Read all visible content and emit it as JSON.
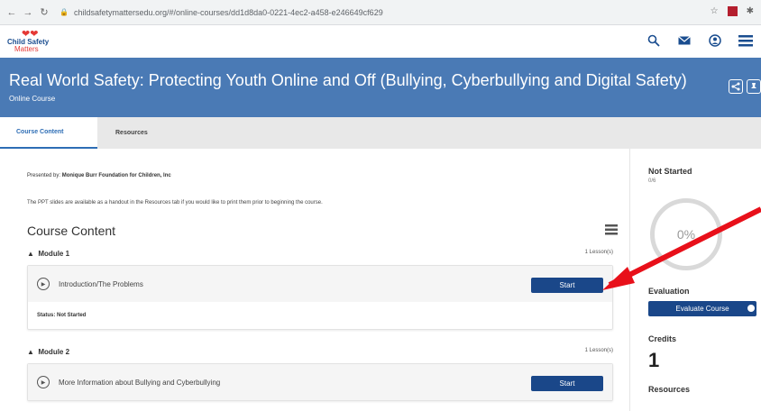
{
  "browser": {
    "url": "childsafetymattersedu.org/#/online-courses/dd1d8da0-0221-4ec2-a458-e246649cf629"
  },
  "logo": {
    "line1": "Child Safety",
    "line2": "Matters"
  },
  "banner": {
    "title": "Real World Safety: Protecting Youth Online and Off (Bullying, Cyberbullying and Digital Safety)",
    "subtitle": "Online Course"
  },
  "tabs": [
    {
      "label": "Course Content"
    },
    {
      "label": "Resources"
    }
  ],
  "main": {
    "presented_label": "Presented by:",
    "presented_by": "Monique Burr Foundation for Children, Inc",
    "ppt_note": "The PPT slides are available as a handout in the Resources tab if you would like to print them prior to beginning the course.",
    "section_title": "Course Content",
    "modules": [
      {
        "name": "Module 1",
        "count": "1 Lesson(s)",
        "lesson": "Introduction/The Problems",
        "button": "Start",
        "status": "Status: Not Started"
      },
      {
        "name": "Module 2",
        "count": "1 Lesson(s)",
        "lesson": "More Information about Bullying and Cyberbullying",
        "button": "Start"
      }
    ]
  },
  "sidebar": {
    "status_title": "Not Started",
    "status_count": "0/6",
    "progress": "0%",
    "evaluation_title": "Evaluation",
    "evaluate_button": "Evaluate Course",
    "credits_title": "Credits",
    "credits_value": "1",
    "resources_title": "Resources"
  },
  "colors": {
    "banner": "#4a7ab5",
    "button": "#1a4789",
    "arrow": "#e8101a"
  }
}
